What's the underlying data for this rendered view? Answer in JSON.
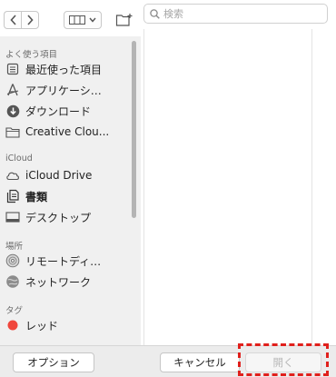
{
  "search": {
    "placeholder": "検索"
  },
  "sidebar": {
    "sections": [
      {
        "title": "よく使う項目",
        "items": [
          {
            "label": "最近使った項目",
            "icon": "recents-icon"
          },
          {
            "label": "アプリケーシ…",
            "icon": "applications-icon"
          },
          {
            "label": "ダウンロード",
            "icon": "downloads-icon"
          },
          {
            "label": "Creative Clou...",
            "icon": "folder-icon"
          }
        ]
      },
      {
        "title": "iCloud",
        "items": [
          {
            "label": "iCloud Drive",
            "icon": "cloud-icon"
          },
          {
            "label": "書類",
            "icon": "documents-icon",
            "selected": true
          },
          {
            "label": "デスクトップ",
            "icon": "desktop-icon"
          }
        ]
      },
      {
        "title": "場所",
        "items": [
          {
            "label": "リモートディ…",
            "icon": "remote-disc-icon"
          },
          {
            "label": "ネットワーク",
            "icon": "network-icon"
          }
        ]
      },
      {
        "title": "タグ",
        "items": [
          {
            "label": "レッド",
            "icon": "red-tag-icon",
            "color": "#f0463c"
          }
        ]
      }
    ]
  },
  "buttons": {
    "options": "オプション",
    "cancel": "キャンセル",
    "open": "開く"
  },
  "colors": {
    "highlight": "#e0201c",
    "tag_red": "#f0463c"
  }
}
